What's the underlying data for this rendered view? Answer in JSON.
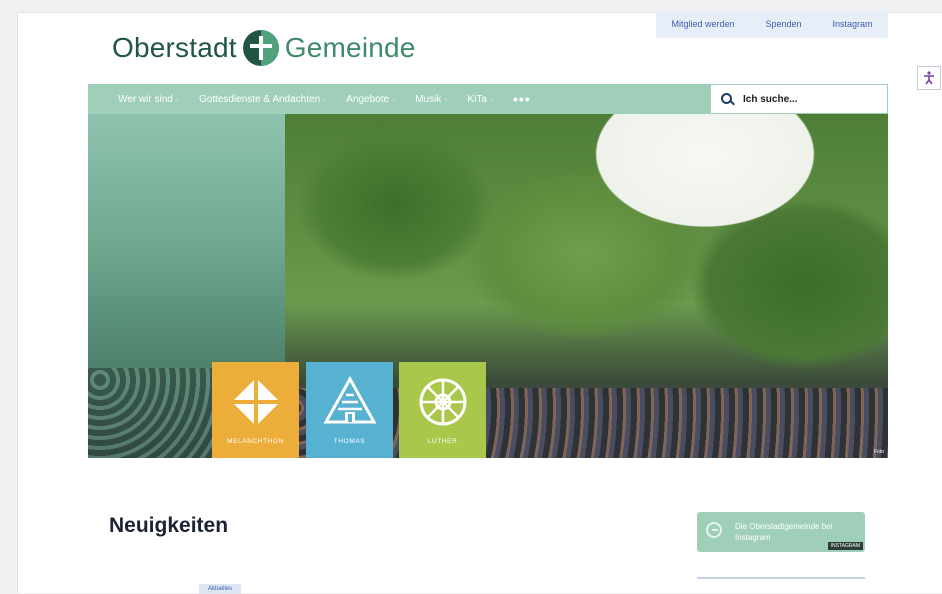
{
  "topbar": {
    "links": [
      "Mitglied werden",
      "Spenden",
      "Instagram"
    ]
  },
  "logo": {
    "word1": "Oberstadt",
    "word2": "Gemeinde"
  },
  "nav": {
    "items": [
      "Wer wir sind ·",
      "Gottesdienste & Andachten ·",
      "Angebote ·",
      "Musik ·",
      "KiTa ·",
      "•••"
    ],
    "search_placeholder": "Ich suche..."
  },
  "hero": {
    "tiles": [
      {
        "label": "MELANCHTHON",
        "color": "#ecad3a"
      },
      {
        "label": "THOMAS",
        "color": "#57b1d0"
      },
      {
        "label": "LUTHER",
        "color": "#a9c84b"
      }
    ],
    "credit": "Foto"
  },
  "main": {
    "heading": "Neuigkeiten",
    "tag": "Aktuelles"
  },
  "sidebar": {
    "instagram_text": "Die Oberstadtgemeinde bei Instagram",
    "instagram_badge": "INSTAGRAM"
  },
  "colors": {
    "nav": "#9fcfb8",
    "logo_dark": "#1f5742",
    "logo_light": "#4fa27c"
  }
}
